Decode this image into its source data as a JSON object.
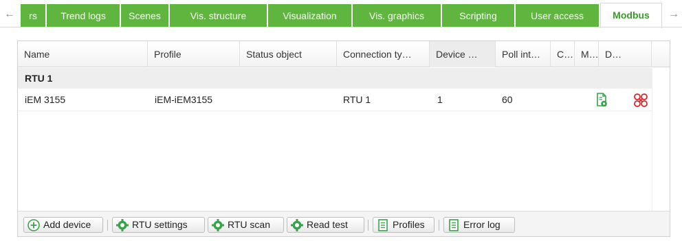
{
  "tabs": {
    "left_arrow": "←",
    "right_arrow": "→",
    "items": [
      {
        "label": "rs"
      },
      {
        "label": "Trend logs"
      },
      {
        "label": "Scenes"
      },
      {
        "label": "Vis. structure"
      },
      {
        "label": "Visualization"
      },
      {
        "label": "Vis. graphics"
      },
      {
        "label": "Scripting"
      },
      {
        "label": "User access"
      },
      {
        "label": "Modbus",
        "active": true
      }
    ]
  },
  "grid": {
    "columns": [
      "Name",
      "Profile",
      "Status object",
      "Connection ty…",
      "Device …",
      "Poll int…",
      "C…",
      "M…",
      "D…"
    ],
    "group": "RTU 1",
    "row": {
      "name": "iEM 3155",
      "profile": "iEM-iEM3155",
      "status_object": "",
      "connection_type": "RTU 1",
      "device": "1",
      "poll_interval": "60"
    }
  },
  "toolbar": {
    "add_device": "Add device",
    "rtu_settings": "RTU settings",
    "rtu_scan": "RTU scan",
    "read_test": "Read test",
    "profiles": "Profiles",
    "error_log": "Error log"
  },
  "colors": {
    "tab_green": "#5fb53d",
    "active_tab_text": "#3a9b2a",
    "icon_green": "#3aa24a",
    "icon_red": "#d9252b"
  }
}
